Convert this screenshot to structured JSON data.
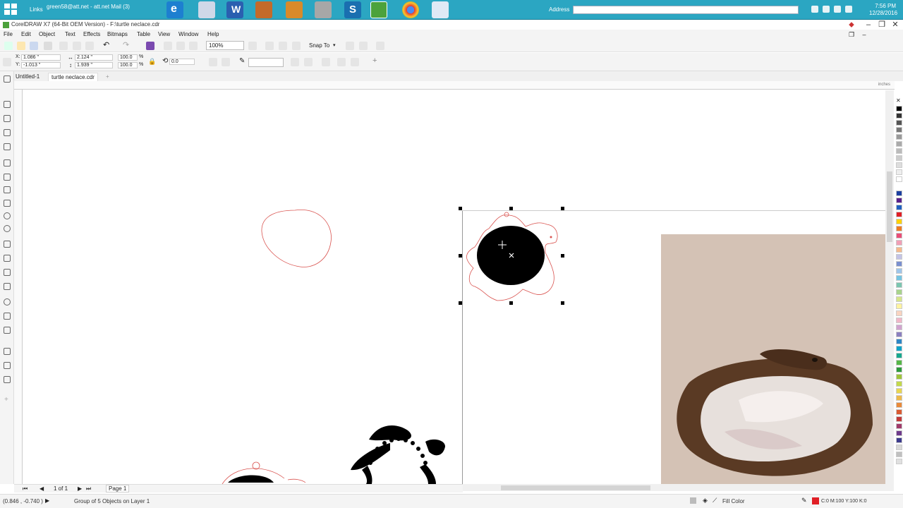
{
  "taskbar": {
    "links_label": "Links",
    "mail_label": "green58@att.net - att.net Mail (3)",
    "address_label": "Address",
    "time": "7:56 PM",
    "date": "12/28/2016",
    "icon_names": [
      "start-icon",
      "ie-icon",
      "calendar-icon",
      "word-icon",
      "app-icon",
      "pen-icon",
      "printer-icon",
      "s-icon",
      "coreldraw-icon",
      "chrome-icon",
      "file-icon"
    ]
  },
  "window": {
    "title": "CorelDRAW X7 (64-Bit OEM Version) - F:\\turtle neclace.cdr"
  },
  "menu": [
    "File",
    "Edit",
    "Object",
    "Text",
    "Effects",
    "Bitmaps",
    "Table",
    "View",
    "Window",
    "Help"
  ],
  "toolbar": {
    "zoom": "100%",
    "snap_to": "Snap To",
    "x_label": "X:",
    "x_value": "1.086 \"",
    "y_label": "Y:",
    "y_value": "-1.013 \"",
    "w_value": "2.124 \"",
    "h_value": "1.939 \"",
    "scale_w": "100.0",
    "scale_h": "100.0",
    "pct": "%",
    "rotation": "0.0"
  },
  "tabs": {
    "untitled": "Untitled-1",
    "active": "turtle neclace.cdr",
    "add": "+"
  },
  "ruler": {
    "units": "inches"
  },
  "pagebar": {
    "page_count": "1 of 1",
    "page_name": "Page 1"
  },
  "status": {
    "coords": "(0.846 , -0.740 )",
    "selection": "Group of 5 Objects on Layer 1",
    "fill_label": "Fill Color",
    "outline_value": "C:0 M:100 Y:100 K:0"
  },
  "colors": {
    "taskbar": "#2ba6c2",
    "outline_red": "#d9534f",
    "selection_black": "#000000"
  }
}
